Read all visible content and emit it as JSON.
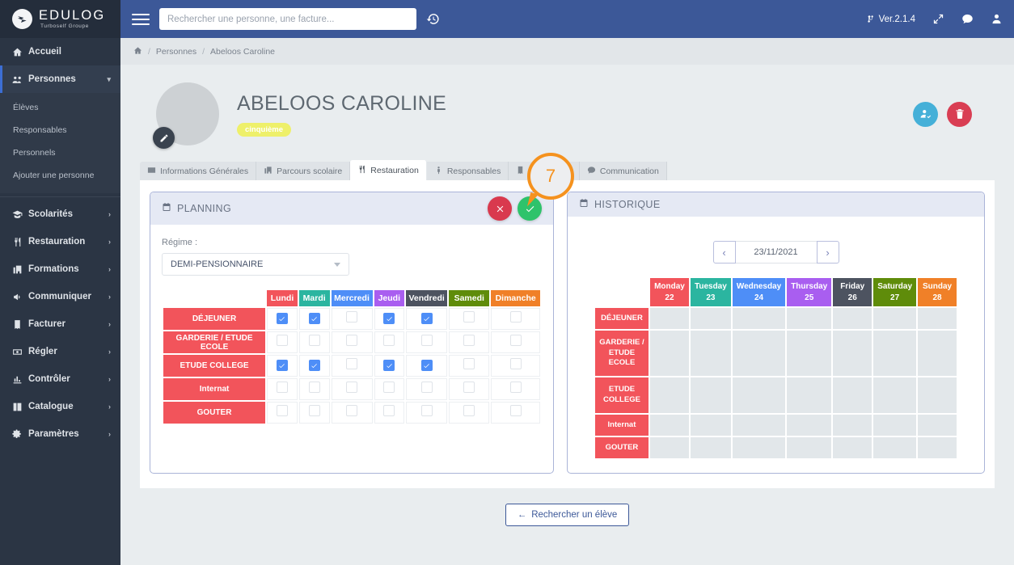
{
  "brand": {
    "name": "EDULOG",
    "tagline": "Turboself Groupe",
    "icon": "bird-logo-icon"
  },
  "sidebar": {
    "items": [
      {
        "label": "Accueil",
        "icon": "home-icon",
        "expandable": false,
        "active": false
      },
      {
        "label": "Personnes",
        "icon": "users-icon",
        "expandable": true,
        "active": true
      },
      {
        "label": "Scolarités",
        "icon": "graduation-cap-icon",
        "expandable": true,
        "active": false
      },
      {
        "label": "Restauration",
        "icon": "cutlery-icon",
        "expandable": true,
        "active": false
      },
      {
        "label": "Formations",
        "icon": "building-icon",
        "expandable": true,
        "active": false
      },
      {
        "label": "Communiquer",
        "icon": "bullhorn-icon",
        "expandable": true,
        "active": false
      },
      {
        "label": "Facturer",
        "icon": "invoice-icon",
        "expandable": true,
        "active": false
      },
      {
        "label": "Régler",
        "icon": "money-icon",
        "expandable": true,
        "active": false
      },
      {
        "label": "Contrôler",
        "icon": "bar-chart-icon",
        "expandable": true,
        "active": false
      },
      {
        "label": "Catalogue",
        "icon": "catalog-icon",
        "expandable": true,
        "active": false
      },
      {
        "label": "Paramètres",
        "icon": "gears-icon",
        "expandable": true,
        "active": false
      }
    ],
    "submenu": {
      "parent": "Personnes",
      "items": [
        "Élèves",
        "Responsables",
        "Personnels",
        "Ajouter une personne"
      ]
    }
  },
  "topbar": {
    "menu_icon": "hamburger-icon",
    "search_placeholder": "Rechercher une personne, une facture...",
    "search_value": "",
    "history_icon": "history-icon",
    "version": "Ver.2.1.4",
    "version_icon": "code-branch-icon",
    "expand_icon": "expand-icon",
    "chat_icon": "chat-icon",
    "user_icon": "user-icon"
  },
  "breadcrumb": {
    "home_icon": "home-icon",
    "separator": "/",
    "items": [
      "Personnes",
      "Abeloos Caroline"
    ]
  },
  "person": {
    "name": "ABELOOS CAROLINE",
    "class_badge": "cinquième",
    "avatar_edit_icon": "edit-icon",
    "actions": [
      {
        "name": "user-check-button",
        "icon": "user-check-icon",
        "color": "#45b0d8"
      },
      {
        "name": "delete-button",
        "icon": "trash-icon",
        "color": "#d93e53"
      }
    ]
  },
  "tabs": [
    {
      "label": "Informations Générales",
      "icon": "id-card-icon",
      "active": false
    },
    {
      "label": "Parcours scolaire",
      "icon": "school-icon",
      "active": false
    },
    {
      "label": "Restauration",
      "icon": "cutlery-icon",
      "active": true
    },
    {
      "label": "Responsables",
      "icon": "person-icon",
      "active": false
    },
    {
      "label": "Facturation",
      "icon": "invoice-icon",
      "active": false
    },
    {
      "label": "Communication",
      "icon": "comment-icon",
      "active": false
    }
  ],
  "annotation": {
    "number": "7"
  },
  "planning": {
    "title": "PLANNING",
    "title_icon": "calendar-icon",
    "cancel_icon": "times-icon",
    "confirm_icon": "check-icon",
    "regime_label": "Régime :",
    "regime_value": "DEMI-PENSIONNAIRE",
    "days": [
      {
        "label": "Lundi",
        "color": "#f2545b"
      },
      {
        "label": "Mardi",
        "color": "#2bb5a0"
      },
      {
        "label": "Mercredi",
        "color": "#4e8ef7"
      },
      {
        "label": "Jeudi",
        "color": "#a95ef0"
      },
      {
        "label": "Vendredi",
        "color": "#4d5360"
      },
      {
        "label": "Samedi",
        "color": "#5f8c0a"
      },
      {
        "label": "Dimanche",
        "color": "#f08028"
      }
    ],
    "rows": [
      {
        "label": "DÉJEUNER",
        "checks": [
          true,
          true,
          false,
          true,
          true,
          false,
          false
        ]
      },
      {
        "label": "GARDERIE / ETUDE ECOLE",
        "checks": [
          false,
          false,
          false,
          false,
          false,
          false,
          false
        ]
      },
      {
        "label": "ETUDE COLLEGE",
        "checks": [
          true,
          true,
          false,
          true,
          true,
          false,
          false
        ]
      },
      {
        "label": "Internat",
        "checks": [
          false,
          false,
          false,
          false,
          false,
          false,
          false
        ]
      },
      {
        "label": "GOUTER",
        "checks": [
          false,
          false,
          false,
          false,
          false,
          false,
          false
        ]
      }
    ]
  },
  "historique": {
    "title": "HISTORIQUE",
    "title_icon": "calendar-icon",
    "prev_label": "‹",
    "next_label": "›",
    "date": "23/11/2021",
    "days": [
      {
        "name": "Monday",
        "num": "22",
        "color": "#f2545b"
      },
      {
        "name": "Tuesday",
        "num": "23",
        "color": "#2bb5a0"
      },
      {
        "name": "Wednesday",
        "num": "24",
        "color": "#4e8ef7"
      },
      {
        "name": "Thursday",
        "num": "25",
        "color": "#a95ef0"
      },
      {
        "name": "Friday",
        "num": "26",
        "color": "#4d5360"
      },
      {
        "name": "Saturday",
        "num": "27",
        "color": "#5f8c0a"
      },
      {
        "name": "Sunday",
        "num": "28",
        "color": "#f08028"
      }
    ],
    "rows": [
      {
        "label": "DÉJEUNER"
      },
      {
        "label": "GARDERIE / ETUDE ECOLE"
      },
      {
        "label": "ETUDE COLLEGE"
      },
      {
        "label": "Internat"
      },
      {
        "label": "GOUTER"
      }
    ]
  },
  "footer": {
    "back_label": "Rechercher un élève",
    "back_icon": "arrow-left-icon"
  },
  "colors": {
    "accent": "#3c5898",
    "sidebar": "#2b3544",
    "page_bg": "#e9edef",
    "row_label": "#f2545b",
    "checkbox_on": "#4e8ef7",
    "annotation": "#f5921e"
  }
}
